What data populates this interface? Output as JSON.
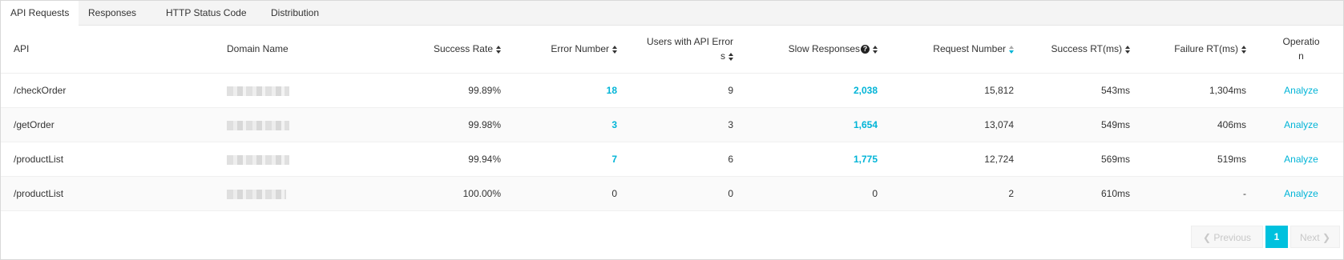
{
  "tabs": [
    {
      "label": "API Requests"
    },
    {
      "label": "Responses"
    },
    {
      "label": "HTTP Status Code"
    },
    {
      "label": "Distribution"
    }
  ],
  "columns": {
    "api": "API",
    "domain": "Domain Name",
    "success_rate": "Success Rate",
    "error_number": "Error Number",
    "users_error_1": "Users with API Error",
    "users_error_2": "s",
    "slow_responses": "Slow Responses",
    "request_number": "Request Number",
    "success_rt": "Success RT(ms)",
    "failure_rt": "Failure RT(ms)",
    "operation_1": "Operatio",
    "operation_2": "n"
  },
  "rows": [
    {
      "api": "/checkOrder",
      "success_rate": "99.89%",
      "error_number": "18",
      "users_error": "9",
      "slow_responses": "2,038",
      "request_number": "15,812",
      "success_rt": "543ms",
      "failure_rt": "1,304ms",
      "action": "Analyze"
    },
    {
      "api": "/getOrder",
      "success_rate": "99.98%",
      "error_number": "3",
      "users_error": "3",
      "slow_responses": "1,654",
      "request_number": "13,074",
      "success_rt": "549ms",
      "failure_rt": "406ms",
      "action": "Analyze"
    },
    {
      "api": "/productList",
      "success_rate": "99.94%",
      "error_number": "7",
      "users_error": "6",
      "slow_responses": "1,775",
      "request_number": "12,724",
      "success_rt": "569ms",
      "failure_rt": "519ms",
      "action": "Analyze"
    },
    {
      "api": "/productList",
      "success_rate": "100.00%",
      "error_number": "0",
      "users_error": "0",
      "slow_responses": "0",
      "request_number": "2",
      "success_rt": "610ms",
      "failure_rt": "-",
      "action": "Analyze"
    }
  ],
  "pagination": {
    "previous": "Previous",
    "current": "1",
    "next": "Next"
  },
  "colors": {
    "accent": "#00b4d7",
    "current_page": "#00c1de"
  },
  "icons": {
    "sort": "sort-icon",
    "help": "help-icon",
    "prev": "chevron-left-icon",
    "next": "chevron-right-icon"
  }
}
